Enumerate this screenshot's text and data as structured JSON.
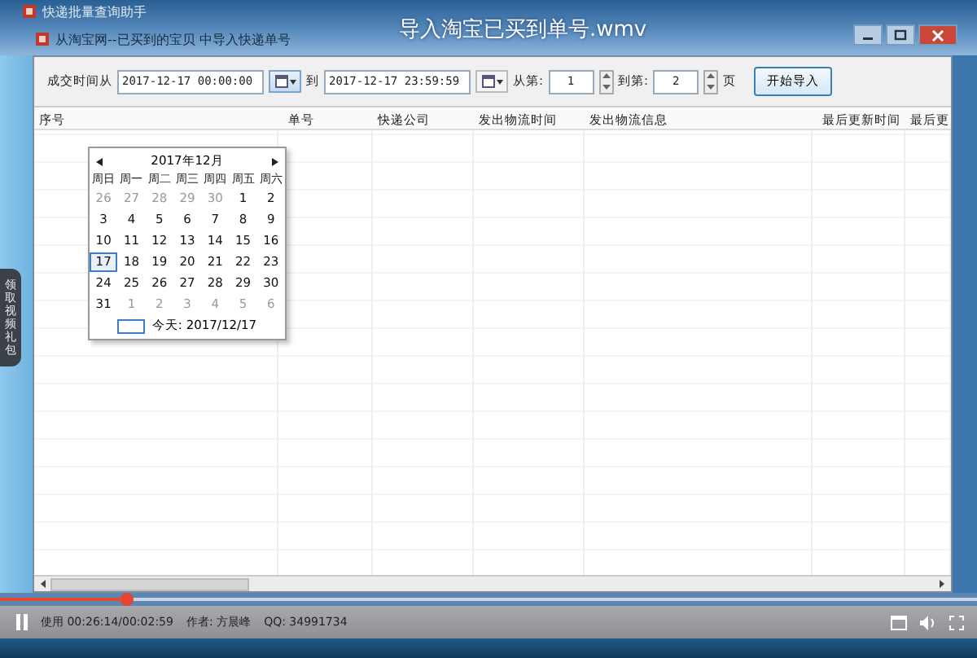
{
  "app_title": "快递批量查询助手",
  "video_title": "导入淘宝已买到单号.wmv",
  "window": {
    "title": "从淘宝网--已买到的宝贝 中导入快递单号"
  },
  "filters": {
    "from_label": "成交时间从",
    "from_value": "2017-12-17 00:00:00",
    "to_label": "到",
    "to_value": "2017-12-17 23:59:59",
    "page_from_label": "从第:",
    "page_from": "1",
    "page_to_label": "到第:",
    "page_to": "2",
    "page_unit": "页",
    "start_button": "开始导入"
  },
  "table": {
    "columns": [
      "序号",
      "单号",
      "快递公司",
      "发出物流时间",
      "发出物流信息",
      "最后更新时间",
      "最后更"
    ]
  },
  "calendar": {
    "month": "2017年12月",
    "weekdays": [
      "周日",
      "周一",
      "周二",
      "周三",
      "周四",
      "周五",
      "周六"
    ],
    "weeks": [
      [
        {
          "day": "26",
          "other_month": true,
          "selected": false
        },
        {
          "day": "27",
          "other_month": true,
          "selected": false
        },
        {
          "day": "28",
          "other_month": true,
          "selected": false
        },
        {
          "day": "29",
          "other_month": true,
          "selected": false
        },
        {
          "day": "30",
          "other_month": true,
          "selected": false
        },
        {
          "day": "1",
          "other_month": false,
          "selected": false
        },
        {
          "day": "2",
          "other_month": false,
          "selected": false
        }
      ],
      [
        {
          "day": "3",
          "other_month": false,
          "selected": false
        },
        {
          "day": "4",
          "other_month": false,
          "selected": false
        },
        {
          "day": "5",
          "other_month": false,
          "selected": false
        },
        {
          "day": "6",
          "other_month": false,
          "selected": false
        },
        {
          "day": "7",
          "other_month": false,
          "selected": false
        },
        {
          "day": "8",
          "other_month": false,
          "selected": false
        },
        {
          "day": "9",
          "other_month": false,
          "selected": false
        }
      ],
      [
        {
          "day": "10",
          "other_month": false,
          "selected": false
        },
        {
          "day": "11",
          "other_month": false,
          "selected": false
        },
        {
          "day": "12",
          "other_month": false,
          "selected": false
        },
        {
          "day": "13",
          "other_month": false,
          "selected": false
        },
        {
          "day": "14",
          "other_month": false,
          "selected": false
        },
        {
          "day": "15",
          "other_month": false,
          "selected": false
        },
        {
          "day": "16",
          "other_month": false,
          "selected": false
        }
      ],
      [
        {
          "day": "17",
          "other_month": false,
          "selected": true
        },
        {
          "day": "18",
          "other_month": false,
          "selected": false
        },
        {
          "day": "19",
          "other_month": false,
          "selected": false
        },
        {
          "day": "20",
          "other_month": false,
          "selected": false
        },
        {
          "day": "21",
          "other_month": false,
          "selected": false
        },
        {
          "day": "22",
          "other_month": false,
          "selected": false
        },
        {
          "day": "23",
          "other_month": false,
          "selected": false
        }
      ],
      [
        {
          "day": "24",
          "other_month": false,
          "selected": false
        },
        {
          "day": "25",
          "other_month": false,
          "selected": false
        },
        {
          "day": "26",
          "other_month": false,
          "selected": false
        },
        {
          "day": "27",
          "other_month": false,
          "selected": false
        },
        {
          "day": "28",
          "other_month": false,
          "selected": false
        },
        {
          "day": "29",
          "other_month": false,
          "selected": false
        },
        {
          "day": "30",
          "other_month": false,
          "selected": false
        }
      ],
      [
        {
          "day": "31",
          "other_month": false,
          "selected": false
        },
        {
          "day": "1",
          "other_month": true,
          "selected": false
        },
        {
          "day": "2",
          "other_month": true,
          "selected": false
        },
        {
          "day": "3",
          "other_month": true,
          "selected": false
        },
        {
          "day": "4",
          "other_month": true,
          "selected": false
        },
        {
          "day": "5",
          "other_month": true,
          "selected": false
        },
        {
          "day": "6",
          "other_month": true,
          "selected": false
        }
      ]
    ],
    "today": "今天: 2017/12/17"
  },
  "side_tab": "领取视频礼包",
  "player": {
    "level": 0.13,
    "time": "使用 00:26:14/00:02:59",
    "author": "作者: 方晨峰",
    "qq": "QQ: 34991734"
  }
}
